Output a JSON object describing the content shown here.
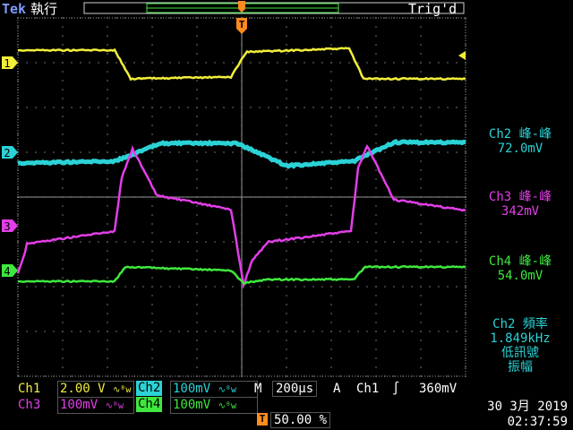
{
  "header": {
    "brand": "Tek",
    "mode": "執行",
    "trigger_status": "Trig'd"
  },
  "channels": [
    {
      "id": "1",
      "marker": "1",
      "color": "#f2ee3a"
    },
    {
      "id": "2",
      "marker": "2",
      "color": "#2bd2d6"
    },
    {
      "id": "3",
      "marker": "3",
      "color": "#e33ee8"
    },
    {
      "id": "4",
      "marker": "4",
      "color": "#3ee83e"
    }
  ],
  "trigger_marker": "T",
  "measurements": {
    "ch2": {
      "label": "Ch2 峰-峰",
      "value": "72.0mV"
    },
    "ch3": {
      "label": "Ch3 峰-峰",
      "value": "342mV"
    },
    "ch4": {
      "label": "Ch4 峰-峰",
      "value": "54.0mV"
    },
    "freq": {
      "line1": "Ch2 頻率",
      "line2": "1.849kHz",
      "line3": "低訊號",
      "line4": "振幅"
    }
  },
  "status_bar": {
    "ch1_label": "Ch1",
    "ch1_scale": "2.00 V",
    "ch2_label": "Ch2",
    "ch2_scale": "100mV",
    "ch3_label": "Ch3",
    "ch3_scale": "100mV",
    "ch4_label": "Ch4",
    "ch4_scale": "100mV",
    "bw_symbol": "∿ᴮw",
    "timebase_label": "M",
    "timebase_value": "200µs",
    "trig_mode": "A",
    "trig_source": "Ch1",
    "trig_slope": "∫",
    "trig_level": "360mV",
    "trig_pos_marker": "T",
    "trig_pos_value": "50.00 %",
    "date": "30 3月  2019",
    "time": "02:37:59"
  },
  "colors": {
    "grid": "#9a9a9a",
    "ch1": "#f2ee3a",
    "ch2": "#2bd2d6",
    "ch3": "#e33ee8",
    "ch4": "#3ee83e",
    "trigger": "#ff8a1e"
  }
}
